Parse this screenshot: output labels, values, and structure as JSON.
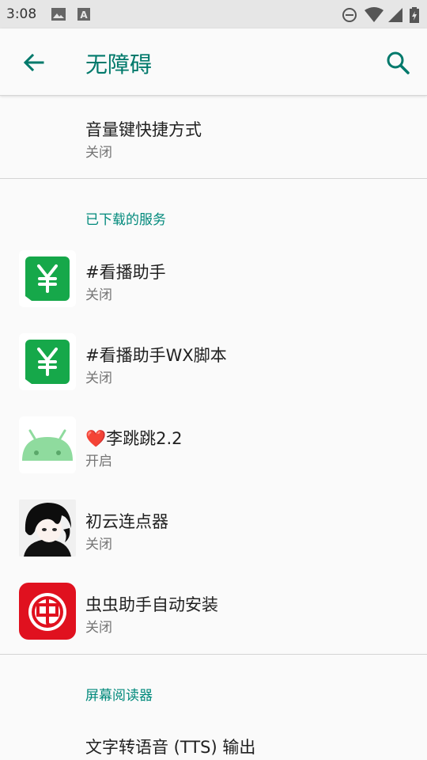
{
  "status_bar": {
    "time": "3:08"
  },
  "toolbar": {
    "title": "无障碍"
  },
  "volume_shortcut": {
    "title": "音量键快捷方式",
    "summary": "关闭"
  },
  "downloaded_services": {
    "header": "已下载的服务",
    "items": [
      {
        "title": "#看播助手",
        "summary": "关闭",
        "icon": "yen-icon"
      },
      {
        "title": "#看播助手WX脚本",
        "summary": "关闭",
        "icon": "yen-icon"
      },
      {
        "title": "❤️李跳跳2.2",
        "summary": "开启",
        "icon": "android-icon"
      },
      {
        "title": "初云连点器",
        "summary": "关闭",
        "icon": "anime-avatar-icon"
      },
      {
        "title": "虫虫助手自动安装",
        "summary": "关闭",
        "icon": "chongchong-icon"
      }
    ]
  },
  "screen_readers": {
    "header": "屏幕阅读器",
    "items": [
      {
        "title": "文字转语音 (TTS) 输出"
      }
    ]
  },
  "colors": {
    "accent": "#00796b",
    "section": "#00897b",
    "green_icon": "#16a84a",
    "red_icon": "#e0111f"
  }
}
